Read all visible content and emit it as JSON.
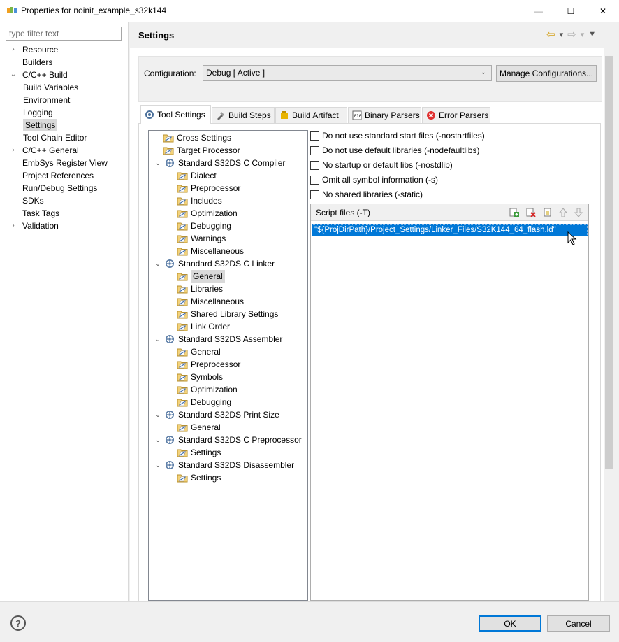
{
  "window": {
    "title": "Properties for noinit_example_s32k144",
    "minimize": "—",
    "maximize": "☐",
    "close": "✕"
  },
  "left_nav": {
    "filter_placeholder": "type filter text",
    "items": [
      {
        "label": "Resource",
        "expander": "›"
      },
      {
        "label": "Builders",
        "expander": ""
      },
      {
        "label": "C/C++ Build",
        "expander": "⌄"
      },
      {
        "label": "Build Variables",
        "expander": ""
      },
      {
        "label": "Environment",
        "expander": ""
      },
      {
        "label": "Logging",
        "expander": ""
      },
      {
        "label": "Settings",
        "expander": ""
      },
      {
        "label": "Tool Chain Editor",
        "expander": ""
      },
      {
        "label": "C/C++ General",
        "expander": "›"
      },
      {
        "label": "EmbSys Register View",
        "expander": ""
      },
      {
        "label": "Project References",
        "expander": ""
      },
      {
        "label": "Run/Debug Settings",
        "expander": ""
      },
      {
        "label": "SDKs",
        "expander": ""
      },
      {
        "label": "Task Tags",
        "expander": ""
      },
      {
        "label": "Validation",
        "expander": "›"
      }
    ]
  },
  "header": {
    "title": "Settings",
    "back_icon": "⇦",
    "forward_icon": "⇨",
    "dropdown_icon": "▾",
    "menu_icon": "▼"
  },
  "configuration": {
    "label": "Configuration:",
    "value": "Debug  [ Active ]",
    "chevron": "⌄",
    "manage_button": "Manage Configurations..."
  },
  "tabs": [
    {
      "label": "Tool Settings",
      "icon": "tool-settings-icon"
    },
    {
      "label": "Build Steps",
      "icon": "build-steps-icon"
    },
    {
      "label": "Build Artifact",
      "icon": "build-artifact-icon"
    },
    {
      "label": "Binary Parsers",
      "icon": "binary-parsers-icon"
    },
    {
      "label": "Error Parsers",
      "icon": "error-parsers-icon"
    }
  ],
  "tool_tree": [
    {
      "label": "Cross Settings",
      "kind": "folder",
      "chev": ""
    },
    {
      "label": "Target Processor",
      "kind": "folder",
      "chev": ""
    },
    {
      "label": "Standard S32DS C Compiler",
      "kind": "tool",
      "chev": "⌄"
    },
    {
      "label": "Dialect",
      "kind": "folder",
      "chev": ""
    },
    {
      "label": "Preprocessor",
      "kind": "folder",
      "chev": ""
    },
    {
      "label": "Includes",
      "kind": "folder",
      "chev": ""
    },
    {
      "label": "Optimization",
      "kind": "folder",
      "chev": ""
    },
    {
      "label": "Debugging",
      "kind": "folder",
      "chev": ""
    },
    {
      "label": "Warnings",
      "kind": "folder",
      "chev": ""
    },
    {
      "label": "Miscellaneous",
      "kind": "folder",
      "chev": ""
    },
    {
      "label": "Standard S32DS C Linker",
      "kind": "tool",
      "chev": "⌄"
    },
    {
      "label": "General",
      "kind": "folder",
      "chev": ""
    },
    {
      "label": "Libraries",
      "kind": "folder",
      "chev": ""
    },
    {
      "label": "Miscellaneous",
      "kind": "folder",
      "chev": ""
    },
    {
      "label": "Shared Library Settings",
      "kind": "folder",
      "chev": ""
    },
    {
      "label": "Link Order",
      "kind": "folder",
      "chev": ""
    },
    {
      "label": "Standard S32DS Assembler",
      "kind": "tool",
      "chev": "⌄"
    },
    {
      "label": "General",
      "kind": "folder",
      "chev": ""
    },
    {
      "label": "Preprocessor",
      "kind": "folder",
      "chev": ""
    },
    {
      "label": "Symbols",
      "kind": "folder",
      "chev": ""
    },
    {
      "label": "Optimization",
      "kind": "folder",
      "chev": ""
    },
    {
      "label": "Debugging",
      "kind": "folder",
      "chev": ""
    },
    {
      "label": "Standard S32DS Print Size",
      "kind": "tool",
      "chev": "⌄"
    },
    {
      "label": "General",
      "kind": "folder",
      "chev": ""
    },
    {
      "label": "Standard S32DS C Preprocessor",
      "kind": "tool",
      "chev": "⌄"
    },
    {
      "label": "Settings",
      "kind": "folder",
      "chev": ""
    },
    {
      "label": "Standard S32DS Disassembler",
      "kind": "tool",
      "chev": "⌄"
    },
    {
      "label": "Settings",
      "kind": "folder",
      "chev": ""
    }
  ],
  "options": [
    {
      "label": "Do not use standard start files (-nostartfiles)",
      "checked": false
    },
    {
      "label": "Do not use default libraries (-nodefaultlibs)",
      "checked": false
    },
    {
      "label": "No startup or default libs (-nostdlib)",
      "checked": false
    },
    {
      "label": "Omit all symbol information (-s)",
      "checked": false
    },
    {
      "label": "No shared libraries (-static)",
      "checked": false
    }
  ],
  "script_files": {
    "title": "Script files (-T)",
    "items": [
      "\"${ProjDirPath}/Project_Settings/Linker_Files/S32K144_64_flash.ld\""
    ]
  },
  "footer": {
    "help": "?",
    "ok": "OK",
    "cancel": "Cancel"
  }
}
